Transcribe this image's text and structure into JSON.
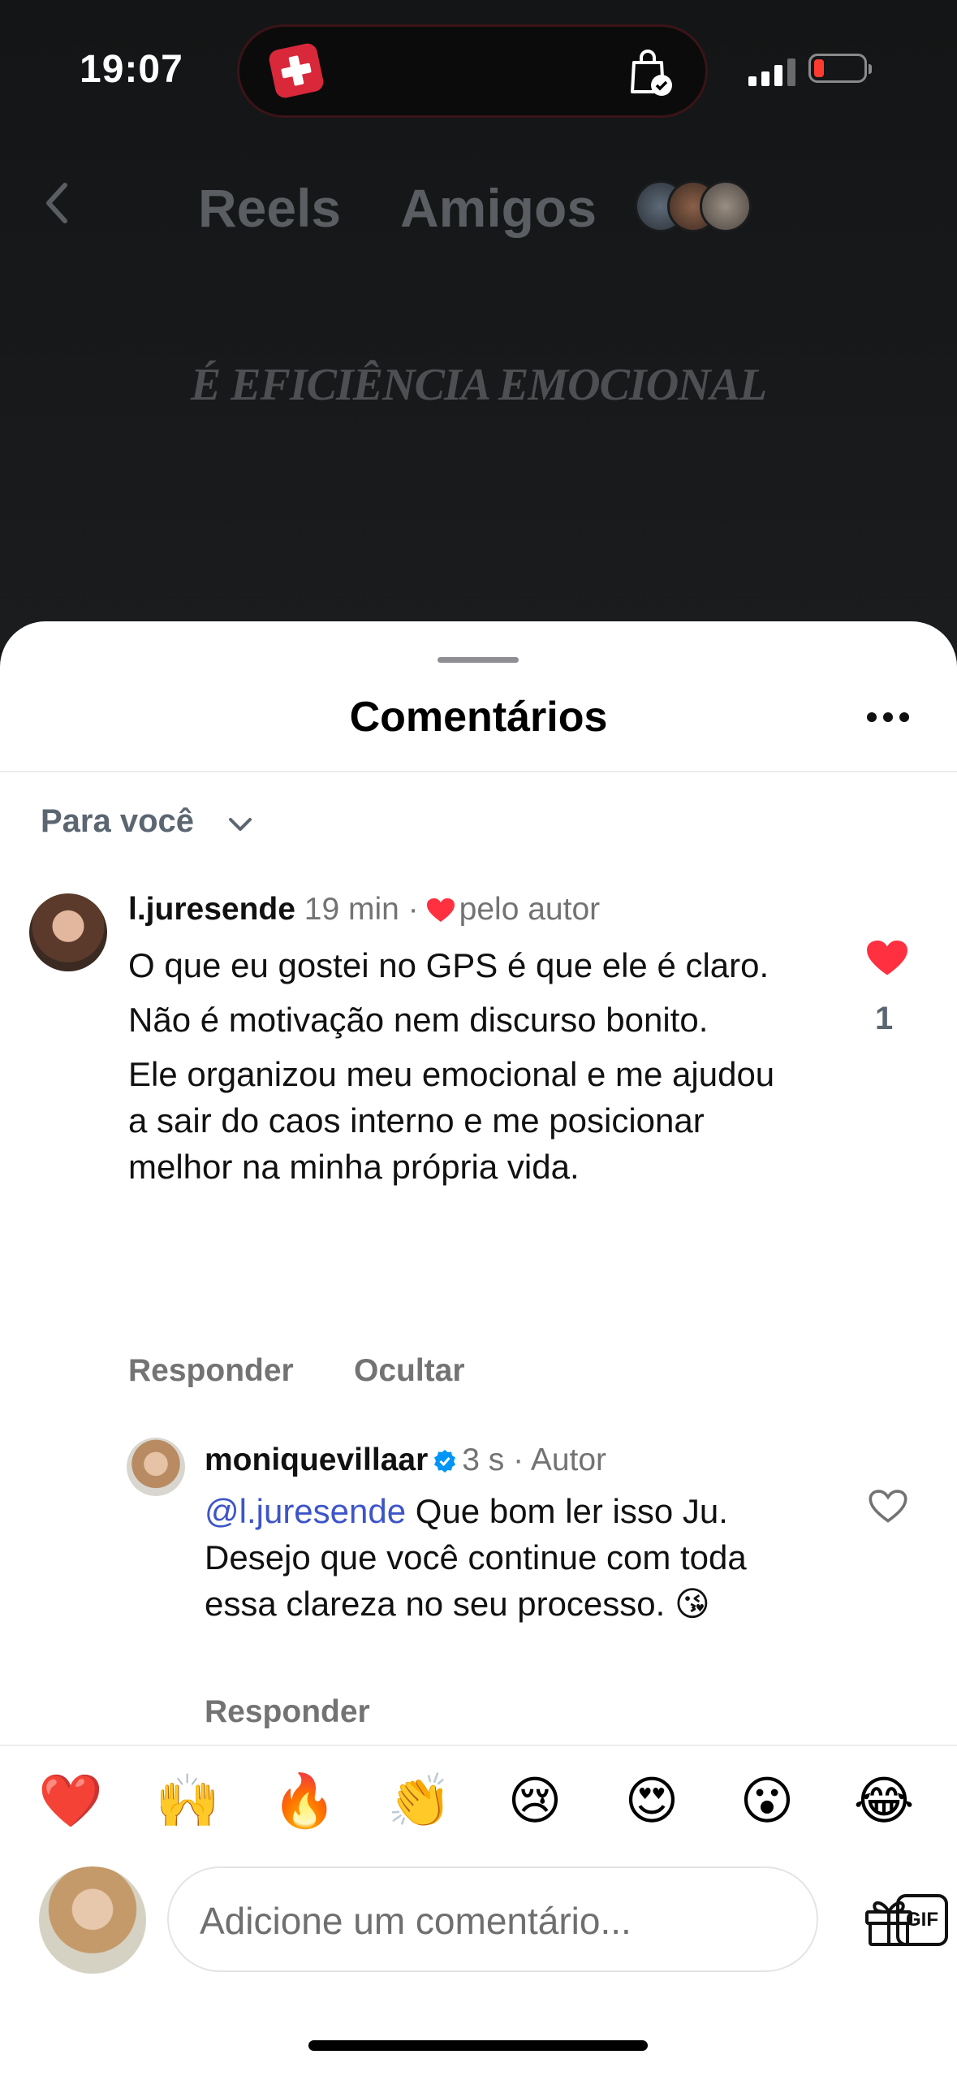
{
  "status_bar": {
    "time": "19:07"
  },
  "nav": {
    "tab_reels": "Reels",
    "tab_amigos": "Amigos"
  },
  "video": {
    "overlay_text": "É EFICIÊNCIA EMOCIONAL"
  },
  "sheet": {
    "title": "Comentários",
    "filter_label": "Para você"
  },
  "comments": [
    {
      "username": "l.juresende",
      "time": "19 min",
      "sep": "·",
      "author_like": "pelo autor",
      "paragraphs": [
        "O que eu gostei no GPS é que ele é claro.",
        "Não é motivação nem discurso bonito.",
        "Ele organizou meu emocional e me ajudou a sair do caos interno e me posicionar melhor na minha própria vida."
      ],
      "like_count": "1",
      "reply_label": "Responder",
      "hide_label": "Ocultar"
    },
    {
      "username": "moniquevillaar",
      "time": "3 s",
      "sep": "·",
      "badge": "Autor",
      "mention": "@l.juresende",
      "text": " Que bom ler isso Ju. Desejo que você continue com toda essa clareza no seu processo. 😘",
      "reply_label": "Responder"
    }
  ],
  "emoji_bar": [
    "❤️",
    "🙌",
    "🔥",
    "👏",
    "😢",
    "😍",
    "😮",
    "😂"
  ],
  "composer": {
    "placeholder": "Adicione um comentário...",
    "gif_label": "GIF"
  },
  "colors": {
    "like_red": "#ff3040",
    "mention_blue": "#3d55c8",
    "verified_blue": "#0095f6"
  }
}
